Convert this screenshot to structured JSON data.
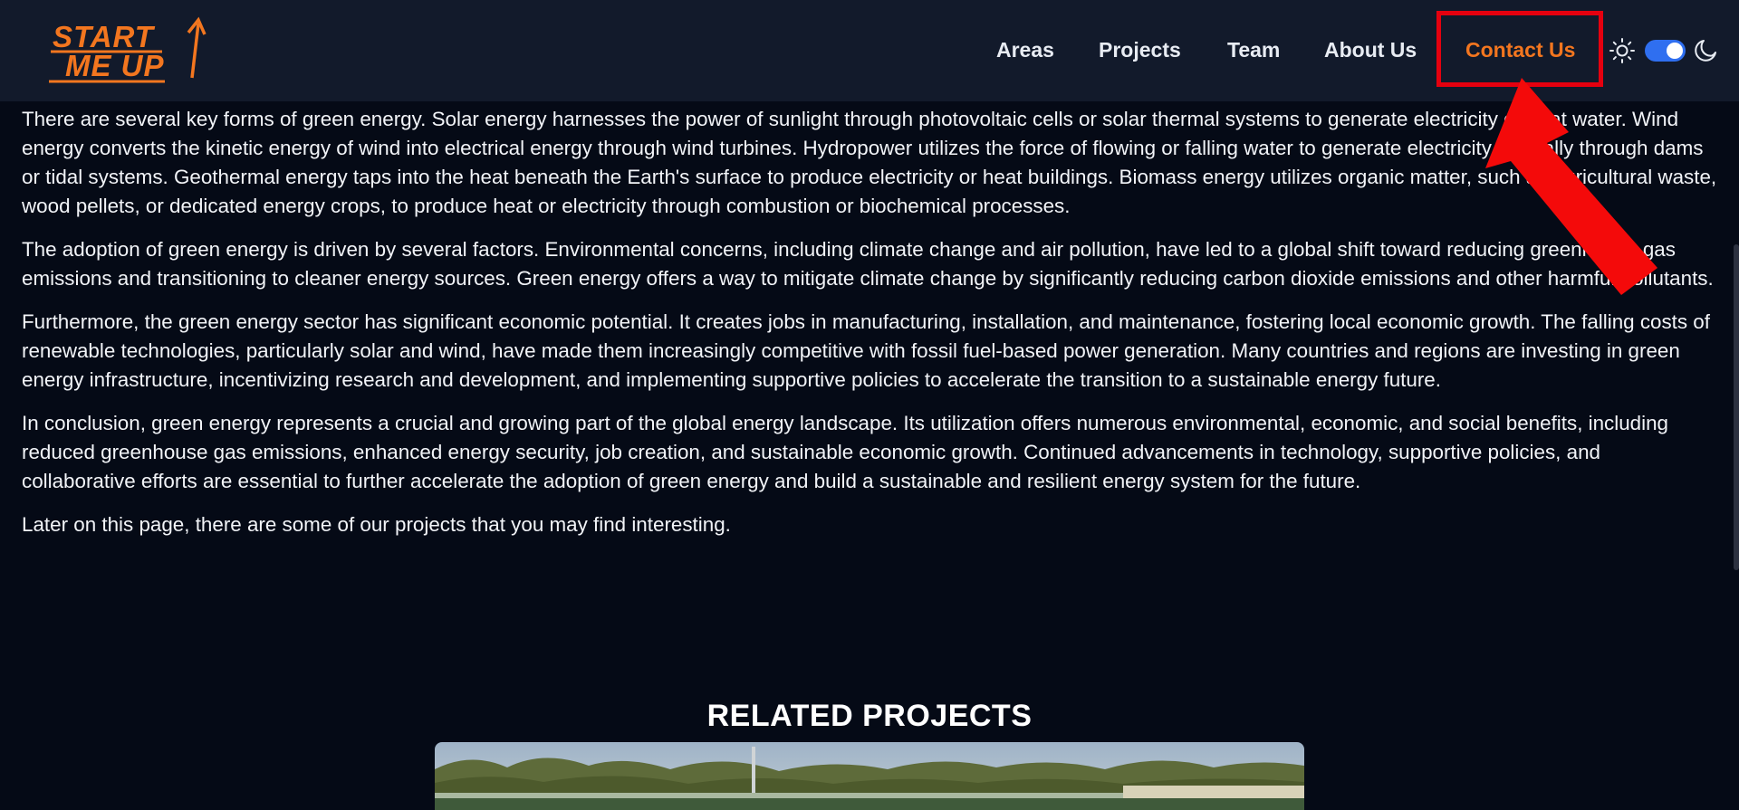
{
  "header": {
    "logo": {
      "line1": "START",
      "line2": "ME UP",
      "color": "#f3761f",
      "icon": "arrow-up-icon"
    },
    "nav": [
      {
        "label": "Areas",
        "active": false
      },
      {
        "label": "Projects",
        "active": false
      },
      {
        "label": "Team",
        "active": false
      },
      {
        "label": "About Us",
        "active": false
      },
      {
        "label": "Contact Us",
        "active": true
      }
    ],
    "theme": {
      "light_icon": "sun-icon",
      "dark_icon": "moon-icon",
      "toggle_on": true,
      "toggle_color": "#2f6ff0"
    },
    "highlight_color": "#e5000f"
  },
  "content": {
    "paragraphs": [
      "There are several key forms of green energy. Solar energy harnesses the power of sunlight through photovoltaic cells or solar thermal systems to generate electricity or heat water. Wind energy converts the kinetic energy of wind into electrical energy through wind turbines. Hydropower utilizes the force of flowing or falling water to generate electricity, typically through dams or tidal systems. Geothermal energy taps into the heat beneath the Earth's surface to produce electricity or heat buildings. Biomass energy utilizes organic matter, such as agricultural waste, wood pellets, or dedicated energy crops, to produce heat or electricity through combustion or biochemical processes.",
      "The adoption of green energy is driven by several factors. Environmental concerns, including climate change and air pollution, have led to a global shift toward reducing greenhouse gas emissions and transitioning to cleaner energy sources. Green energy offers a way to mitigate climate change by significantly reducing carbon dioxide emissions and other harmful pollutants.",
      "Furthermore, the green energy sector has significant economic potential. It creates jobs in manufacturing, installation, and maintenance, fostering local economic growth. The falling costs of renewable technologies, particularly solar and wind, have made them increasingly competitive with fossil fuel-based power generation. Many countries and regions are investing in green energy infrastructure, incentivizing research and development, and implementing supportive policies to accelerate the transition to a sustainable energy future.",
      "In conclusion, green energy represents a crucial and growing part of the global energy landscape. Its utilization offers numerous environmental, economic, and social benefits, including reduced greenhouse gas emissions, enhanced energy security, job creation, and sustainable economic growth. Continued advancements in technology, supportive policies, and collaborative efforts are essential to further accelerate the adoption of green energy and build a sustainable and resilient energy system for the future.",
      "Later on this page, there are some of our projects that you may find interesting."
    ],
    "related_title": "RELATED PROJECTS"
  },
  "colors": {
    "header_bg": "#121a2b",
    "page_bg": "#050a16",
    "accent": "#f3761f",
    "text": "#f2f4f8"
  }
}
